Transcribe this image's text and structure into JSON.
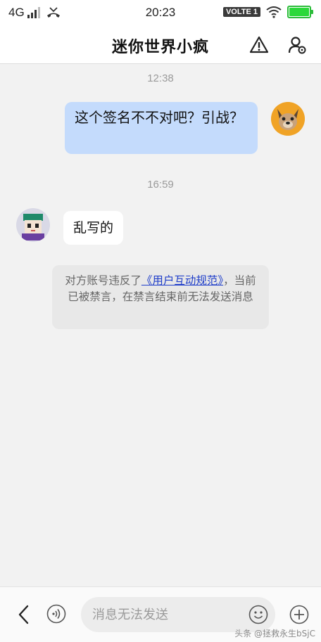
{
  "status_bar": {
    "network": "4G",
    "time": "20:23",
    "volte": "VOLTE 1",
    "battery_level": 1.0
  },
  "header": {
    "title": "迷你世界小疯",
    "icons": [
      "warning-icon",
      "user-settings-icon"
    ]
  },
  "messages": {
    "timestamp_1": "12:38",
    "outgoing_text": "这个签名不不对吧？引战？",
    "timestamp_2": "16:59",
    "incoming_text": "乱写的"
  },
  "notice": {
    "prefix": "对方账号违反了",
    "link": "《用户互动规范》",
    "suffix": "，当前已被禁言，在禁言结束前无法发送消息"
  },
  "input_bar": {
    "placeholder": "消息无法发送",
    "icons": [
      "back-icon",
      "voice-icon",
      "emoji-icon",
      "plus-icon"
    ]
  },
  "watermark": "头条 @拯救永生bSjC",
  "colors": {
    "outgoing_bubble": "#c4dbfc",
    "incoming_bubble": "#ffffff",
    "link": "#1f3ec9",
    "battery": "#2cd83a"
  }
}
